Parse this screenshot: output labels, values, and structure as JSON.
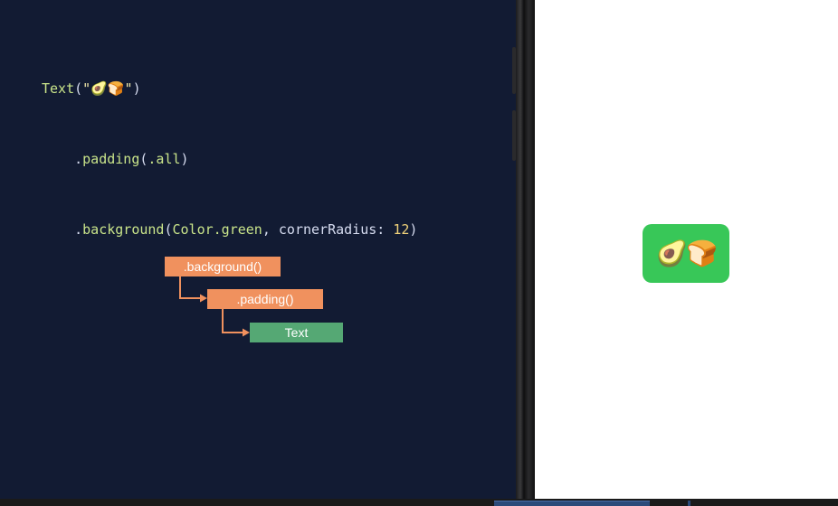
{
  "code": {
    "line1": {
      "call": "Text",
      "open": "(",
      "string": "\"🥑🍞\"",
      "close": ")"
    },
    "line2": {
      "dot": ".",
      "method": "padding",
      "open": "(",
      "arg": ".all",
      "close": ")"
    },
    "line3": {
      "dot": ".",
      "method": "background",
      "open": "(",
      "color_type": "Color",
      "color_member": ".green",
      "comma": ", ",
      "param": "cornerRadius",
      "colon": ": ",
      "value": "12",
      "close": ")"
    }
  },
  "diagram": {
    "nodes": {
      "background": ".background()",
      "padding": ".padding()",
      "text": "Text"
    },
    "colors": {
      "modifier": "#f0915e",
      "view": "#55a874",
      "arrow": "#f0915e"
    }
  },
  "preview": {
    "content": "🥑🍞",
    "background_color": "#38c758"
  },
  "icons": {
    "arrow1": "arrow-right-icon",
    "arrow2": "arrow-right-icon"
  }
}
